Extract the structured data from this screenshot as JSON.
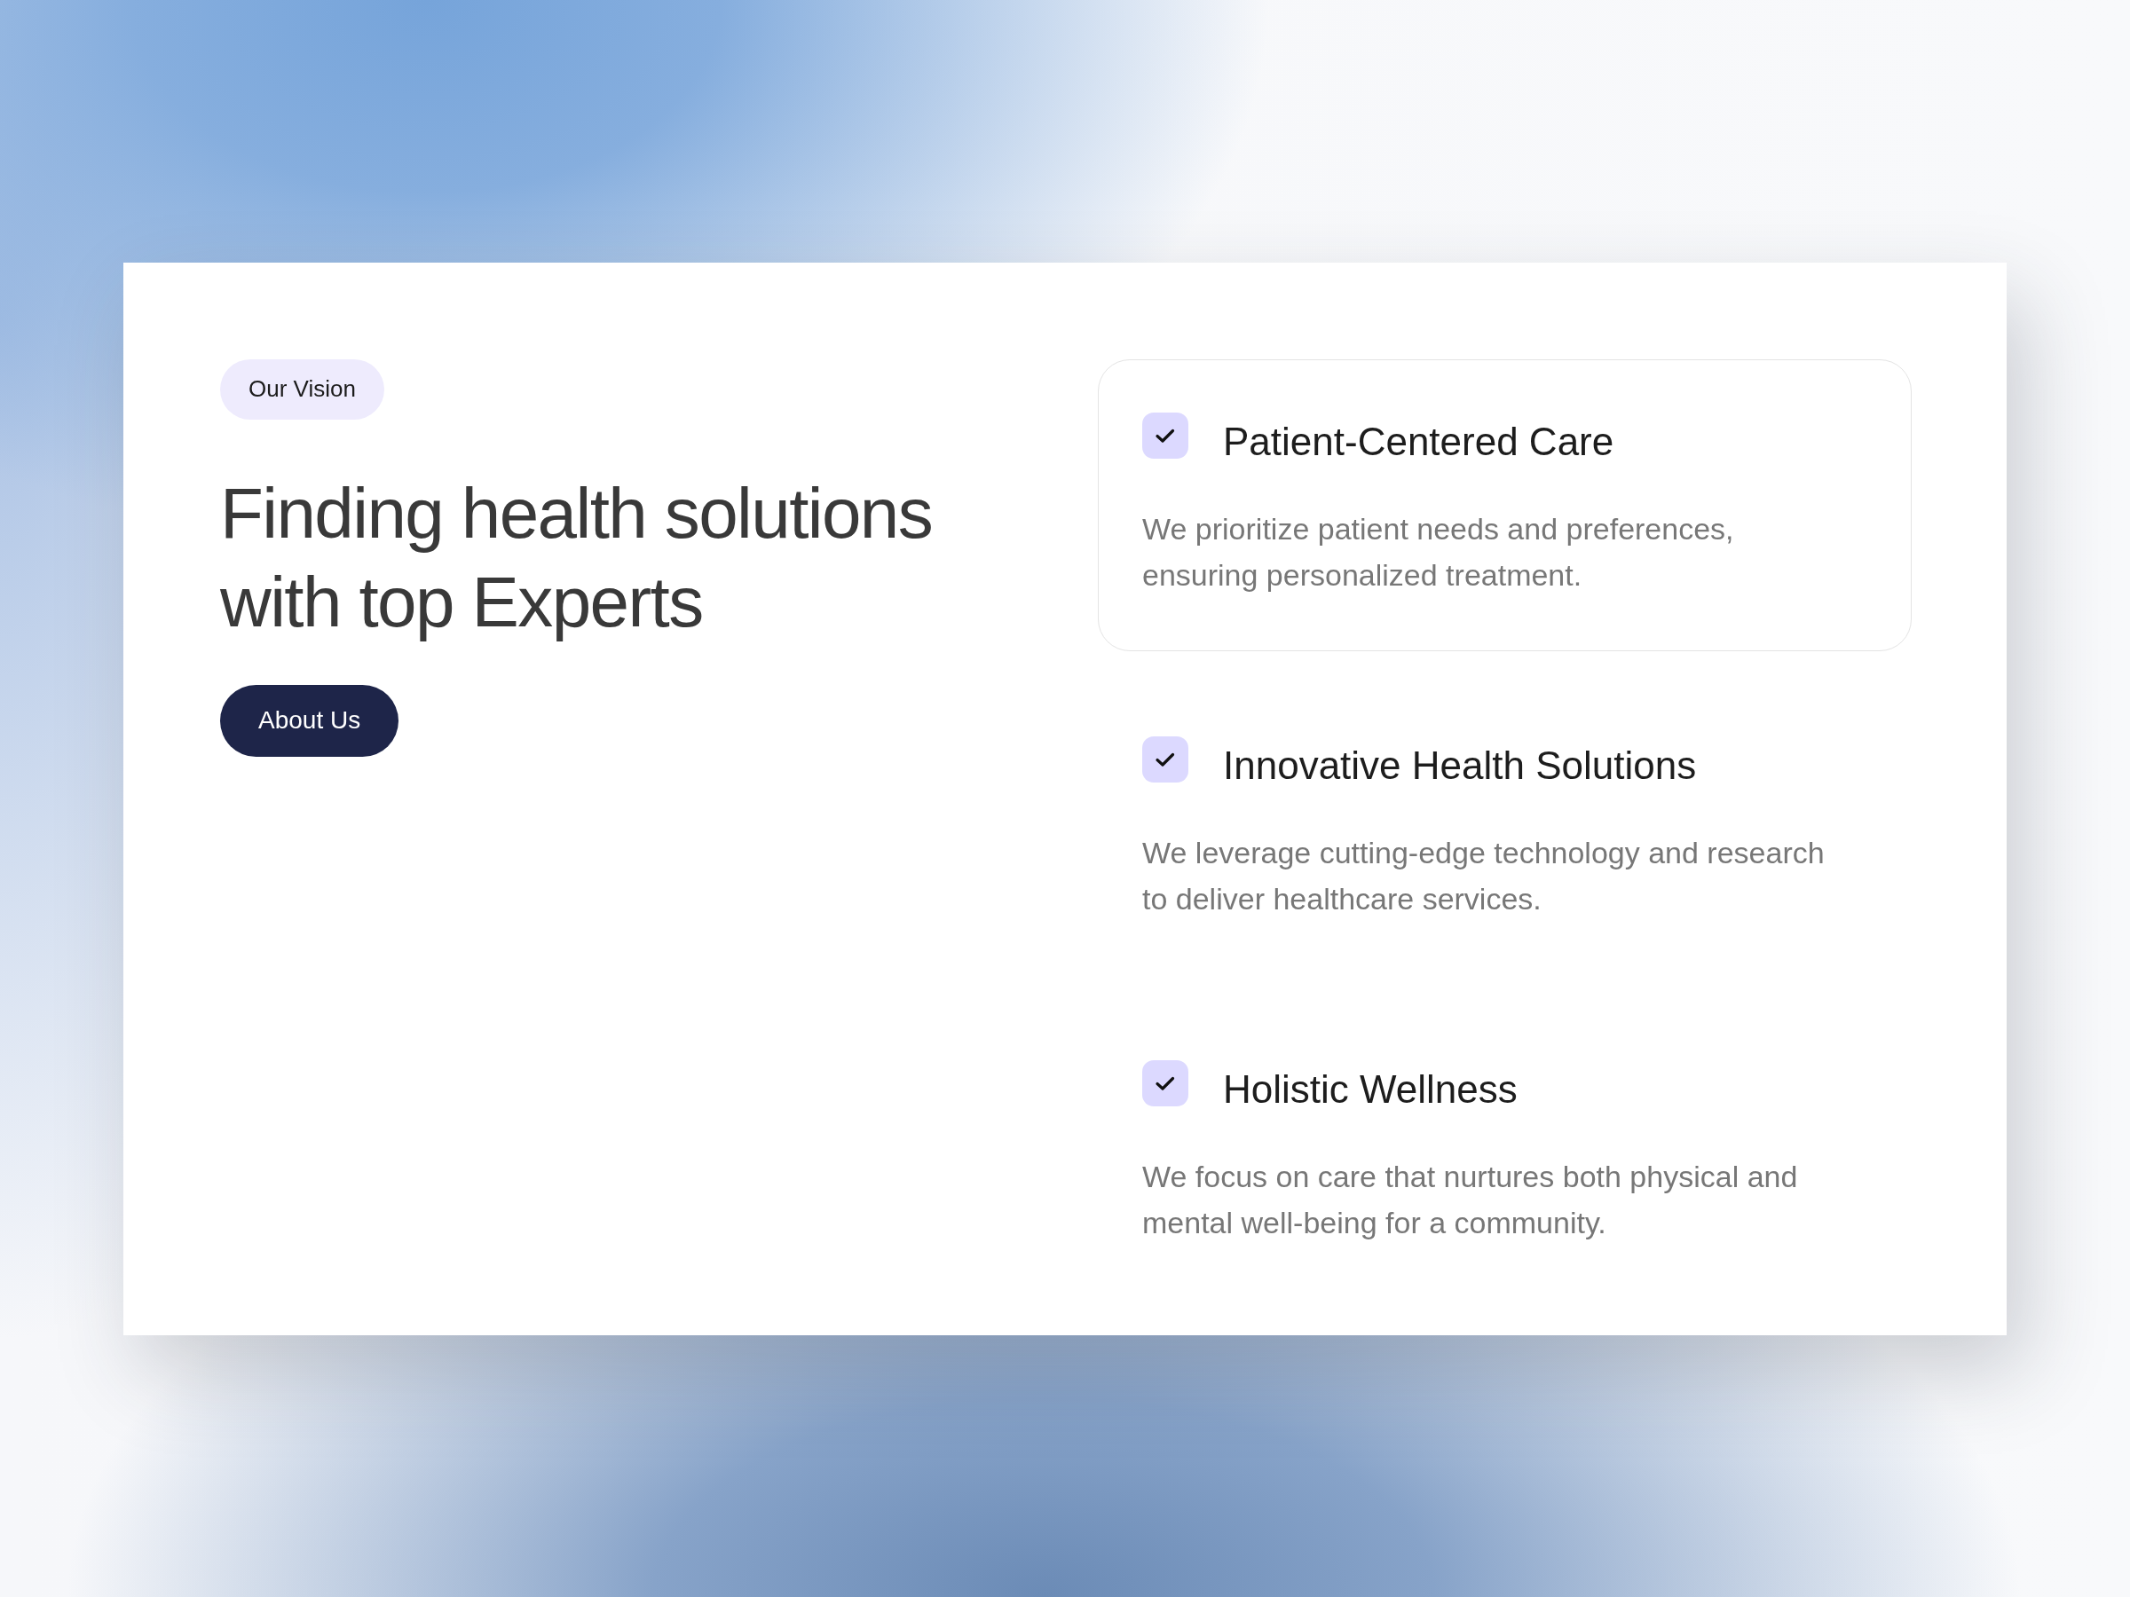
{
  "badge": "Our Vision",
  "heading": "Finding health solutions with top Experts",
  "button": "About Us",
  "features": [
    {
      "title": "Patient-Centered Care",
      "description": "We prioritize patient needs and preferences, ensuring personalized treatment.",
      "selected": true
    },
    {
      "title": "Innovative Health Solutions",
      "description": "We leverage cutting-edge technology and research to deliver healthcare services.",
      "selected": false
    },
    {
      "title": "Holistic Wellness",
      "description": "We focus on care that nurtures both physical and mental well-being for a community.",
      "selected": false
    }
  ]
}
